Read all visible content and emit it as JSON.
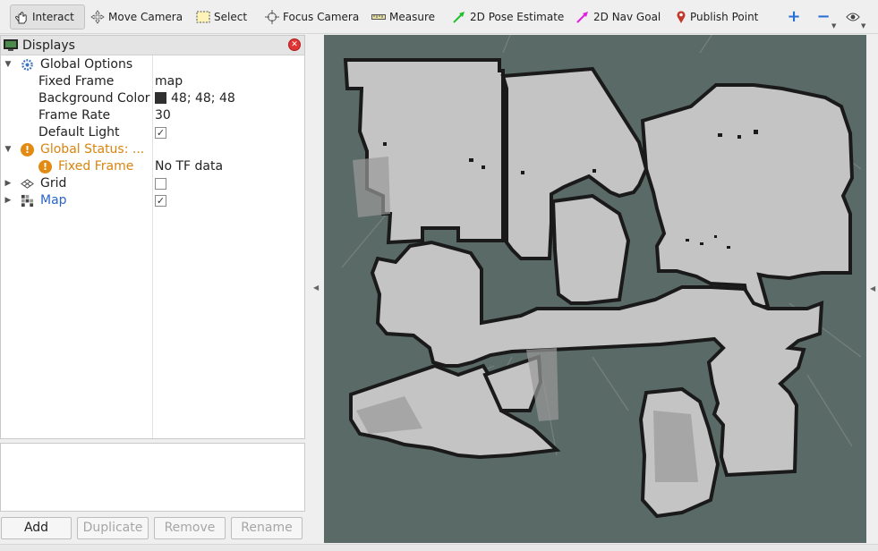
{
  "toolbar": {
    "tools": [
      {
        "label": "Interact",
        "icon": "hand-pointer-icon"
      },
      {
        "label": "Move Camera",
        "icon": "move-camera-icon"
      },
      {
        "label": "Select",
        "icon": "select-rect-icon"
      },
      {
        "label": "Focus Camera",
        "icon": "focus-camera-icon"
      },
      {
        "label": "Measure",
        "icon": "ruler-icon"
      },
      {
        "label": "2D Pose Estimate",
        "icon": "green-arrow-icon"
      },
      {
        "label": "2D Nav Goal",
        "icon": "magenta-arrow-icon"
      },
      {
        "label": "Publish Point",
        "icon": "map-pin-icon"
      }
    ],
    "extra_icons": [
      "plus-icon",
      "minus-icon",
      "eye-icon"
    ]
  },
  "displays": {
    "title": "Displays",
    "tree": {
      "global_options": {
        "label": "Global Options"
      },
      "fixed_frame": {
        "label": "Fixed Frame",
        "value": "map"
      },
      "background_color": {
        "label": "Background Color",
        "value": "48; 48; 48",
        "color": "#303030"
      },
      "frame_rate": {
        "label": "Frame Rate",
        "value": "30"
      },
      "default_light": {
        "label": "Default Light",
        "checked": true
      },
      "global_status": {
        "label": "Global Status: ..."
      },
      "status_fixed_frame": {
        "label": "Fixed Frame",
        "value": "No TF data"
      },
      "grid": {
        "label": "Grid",
        "checked": false
      },
      "map": {
        "label": "Map",
        "checked": true
      }
    }
  },
  "buttons": {
    "add": "Add",
    "duplicate": "Duplicate",
    "remove": "Remove",
    "rename": "Rename"
  },
  "colors": {
    "viewport_bg": "#5a6a67",
    "map_free": "#c4c4c4",
    "map_wall": "#1a1a1a",
    "warning": "#e38a12",
    "link_blue": "#2a66c8"
  }
}
